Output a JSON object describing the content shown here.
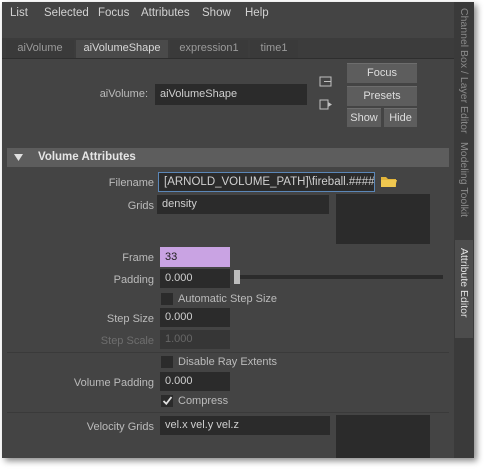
{
  "menu": [
    "List",
    "Selected",
    "Focus",
    "Attributes",
    "Show",
    "Help"
  ],
  "tabs": [
    "aiVolume",
    "aiVolumeShape",
    "expression1",
    "time1"
  ],
  "node": {
    "label": "aiVolume:",
    "value": "aiVolumeShape"
  },
  "buttons": {
    "focus": "Focus",
    "presets": "Presets",
    "show": "Show",
    "hide": "Hide"
  },
  "section": {
    "title": "Volume Attributes"
  },
  "attributes": {
    "filename": {
      "label": "Filename",
      "value": "[ARNOLD_VOLUME_PATH]\\fireball.####.vdb"
    },
    "grids": {
      "label": "Grids",
      "value": "density"
    },
    "frame": {
      "label": "Frame",
      "value": "33"
    },
    "padding": {
      "label": "Padding",
      "value": "0.000"
    },
    "auto_step": {
      "label": "Automatic Step Size",
      "checked": false
    },
    "step_size": {
      "label": "Step Size",
      "value": "0.000"
    },
    "step_scale": {
      "label": "Step Scale",
      "value": "1.000"
    },
    "disable_ray": {
      "label": "Disable Ray Extents",
      "checked": false
    },
    "volume_padding": {
      "label": "Volume Padding",
      "value": "0.000"
    },
    "compress": {
      "label": "Compress",
      "checked": true
    },
    "velocity_grids": {
      "label": "Velocity Grids",
      "value": "vel.x vel.y vel.z"
    }
  },
  "side_tabs": [
    "Channel Box / Layer Editor",
    "Modeling Toolkit",
    "Attribute Editor"
  ],
  "colors": {
    "frame_highlight": "#c9a3e3",
    "folder_icon": "#e3b53a",
    "section_bg": "#5d5d5d"
  },
  "icons": [
    "triangle-down-icon",
    "folder-icon",
    "node-icon",
    "output-icon",
    "checkmark-icon"
  ]
}
